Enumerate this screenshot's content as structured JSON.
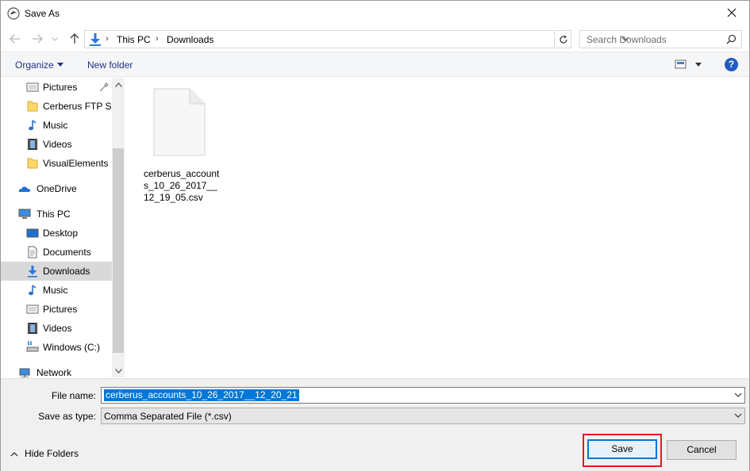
{
  "window": {
    "title": "Save As"
  },
  "address": {
    "crumbs": [
      "This PC",
      "Downloads"
    ],
    "search_placeholder": "Search Downloads"
  },
  "commands": {
    "organize": "Organize",
    "new_folder": "New folder",
    "help": "?"
  },
  "nav_tree": [
    {
      "label": "Pictures",
      "icon": "pictures-icon",
      "pinned": true
    },
    {
      "label": "Cerberus FTP Se",
      "icon": "folder-icon"
    },
    {
      "label": "Music",
      "icon": "music-icon"
    },
    {
      "label": "Videos",
      "icon": "videos-icon"
    },
    {
      "label": "VisualElements",
      "icon": "folder-icon"
    },
    {
      "label": "OneDrive",
      "icon": "onedrive-icon"
    },
    {
      "label": "This PC",
      "icon": "this-pc-icon"
    },
    {
      "label": "Desktop",
      "icon": "desktop-icon"
    },
    {
      "label": "Documents",
      "icon": "documents-icon"
    },
    {
      "label": "Downloads",
      "icon": "downloads-icon",
      "selected": true
    },
    {
      "label": "Music",
      "icon": "music-icon"
    },
    {
      "label": "Pictures",
      "icon": "pictures-icon"
    },
    {
      "label": "Videos",
      "icon": "videos-icon"
    },
    {
      "label": "Windows (C:)",
      "icon": "drive-icon"
    },
    {
      "label": "Network",
      "icon": "network-icon"
    }
  ],
  "files": [
    {
      "name": "cerberus_accounts_10_26_2017__12_19_05.csv",
      "icon": "file-icon"
    }
  ],
  "form": {
    "file_name_label": "File name:",
    "file_name_value": "cerberus_accounts_10_26_2017__12_20_21",
    "save_type_label": "Save as type:",
    "save_type_value": "Comma Separated File (*.csv)",
    "hide_folders": "Hide Folders",
    "save": "Save",
    "cancel": "Cancel"
  },
  "colors": {
    "accent": "#0078d7",
    "selection": "#d9d9d9",
    "highlight": "#e01a22",
    "link": "#1e3287"
  }
}
